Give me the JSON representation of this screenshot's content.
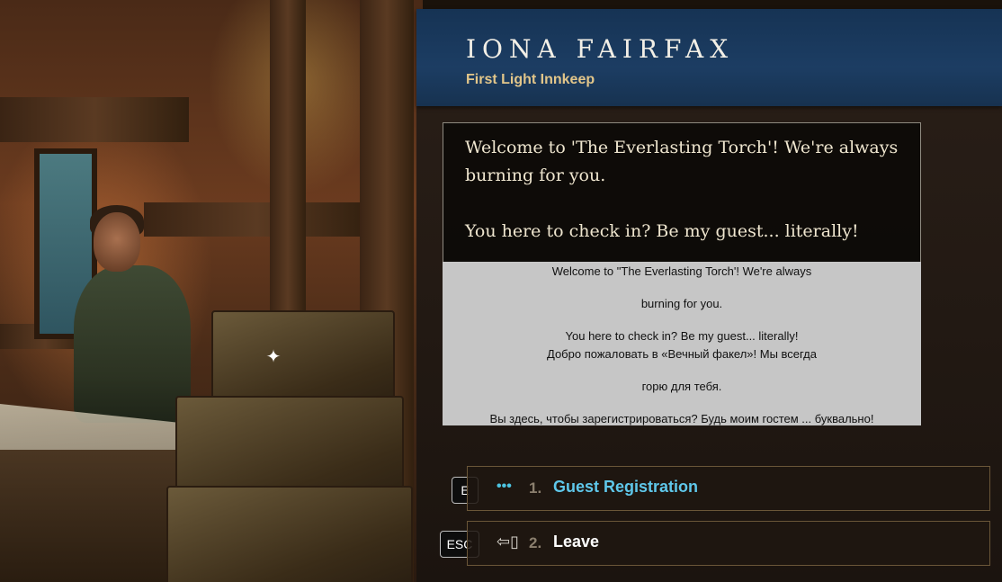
{
  "npc": {
    "name": "IONA FAIRFAX",
    "title": "First Light Innkeep"
  },
  "dialogue": {
    "line1": "Welcome to 'The Everlasting Torch'! We're always",
    "line2": "burning for you.",
    "line3": "You here to check in? Be my guest... literally!"
  },
  "subtitles_en": {
    "line1": "Welcome to \"The Everlasting Torch'! We're always",
    "line2": "burning for you.",
    "line3": "You here to check in? Be my guest... literally!"
  },
  "subtitles_ru": {
    "line1": "Добро пожаловать в «Вечный факел»! Мы всегда",
    "line2": "горю для тебя.",
    "line3": "Вы здесь, чтобы зарегистрироваться?  Будь моим гостем ... буквально!"
  },
  "options": [
    {
      "key": "E",
      "icon": "ellipsis-icon",
      "number": "1.",
      "label": "Guest Registration"
    },
    {
      "key": "ESC",
      "icon": "exit-door-icon",
      "number": "2.",
      "label": "Leave"
    }
  ],
  "colors": {
    "header_blue": "#1c3d63",
    "title_gold": "#e2c68a",
    "option_cyan": "#5fc7ea"
  }
}
